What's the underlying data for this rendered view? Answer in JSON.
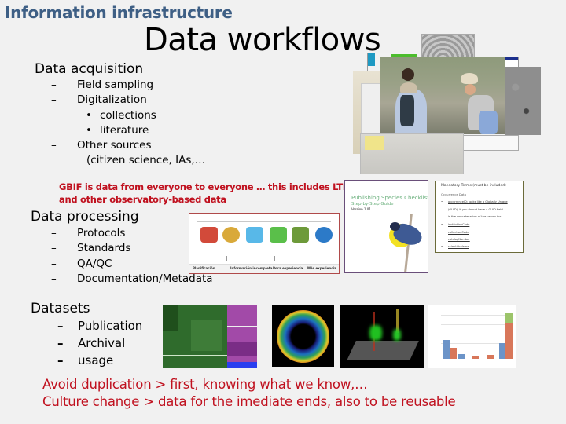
{
  "header": {
    "section": "Information infrastructure",
    "title": "Data workflows"
  },
  "acquisition": {
    "heading": "Data acquisition",
    "items": [
      {
        "marker": "–",
        "label": "Field sampling"
      },
      {
        "marker": "–",
        "label": "Digitalization",
        "children": [
          {
            "marker": "•",
            "label": "collections"
          },
          {
            "marker": "•",
            "label": "literature"
          }
        ]
      },
      {
        "marker": "–",
        "label": "Other sources",
        "continuation": "(citizen science, IAs,…"
      }
    ]
  },
  "gbif_note": {
    "line1": "GBIF is data from everyone to everyone … this includes LTER",
    "line2": "and other observatory-based data"
  },
  "processing": {
    "heading": "Data processing",
    "items": [
      {
        "marker": "–",
        "label": "Protocols"
      },
      {
        "marker": "–",
        "label": "Standards"
      },
      {
        "marker": "–",
        "label": "QA/QC"
      },
      {
        "marker": "–",
        "label": "Documentation/Metadata"
      }
    ]
  },
  "datasets": {
    "heading": "Datasets",
    "items": [
      {
        "marker": "–",
        "label": "Publication"
      },
      {
        "marker": "–",
        "label": "Archival"
      },
      {
        "marker": "–",
        "label": "usage"
      }
    ]
  },
  "conclusions": {
    "line1": "Avoid duplication > first, knowing what we know,…",
    "line2": "Culture change > data for the imediate ends, also to be reusable"
  },
  "images": {
    "field_collage": "field-sampling-photo-collage",
    "process_diagram": {
      "footer": [
        "Planificación",
        "Información incompleta",
        "Poca experiencia",
        "Más experiencia"
      ]
    },
    "guide_cover": {
      "title": "Publishing Species Checklists",
      "subtitle": "Step-by-Step Guide",
      "version": "Version 1.01"
    },
    "terms_doc": {
      "heading": "Mandatory Terms (must be included)",
      "subheading": "Occurrence Data",
      "rows": [
        "occurrenceID: looks like a Globally Unique",
        "(GUID). If you do not have a GUID field",
        "is the concatenation of the values for",
        "institutionCode",
        "collectionCode",
        "catalogNumber",
        "scientificName"
      ]
    }
  },
  "colors": {
    "section_header": "#3e5f85",
    "accent_red": "#c0111f",
    "background": "#f1f1f1"
  }
}
